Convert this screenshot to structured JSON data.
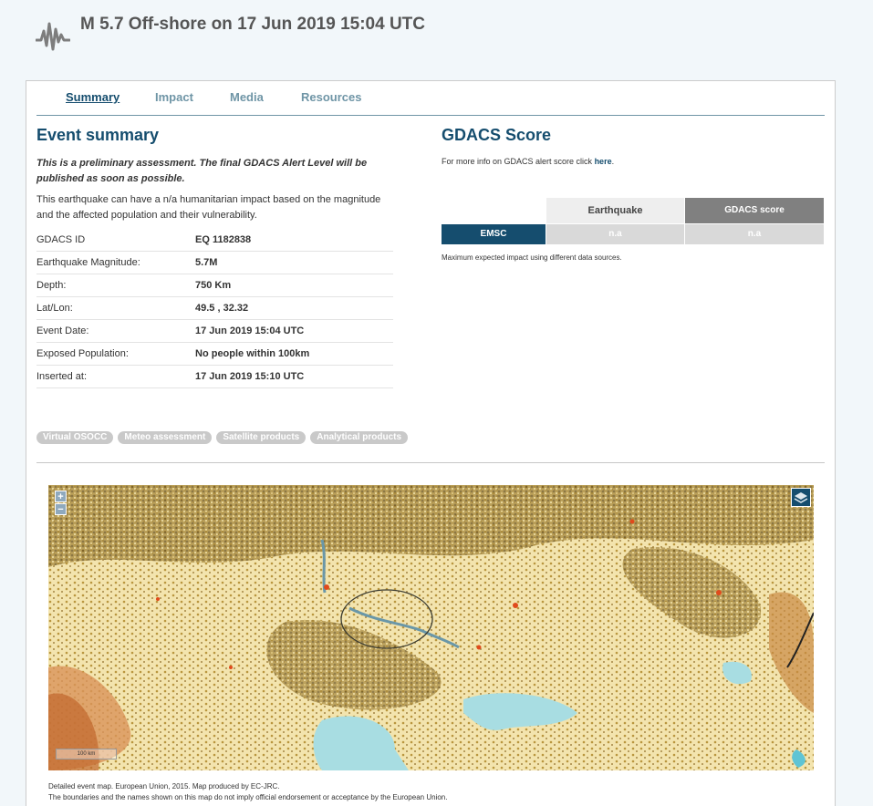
{
  "page": {
    "title": "M 5.7 Off-shore on 17 Jun 2019 15:04 UTC",
    "logo_icon": "seismograph-icon"
  },
  "tabs": [
    {
      "label": "Summary",
      "active": true
    },
    {
      "label": "Impact",
      "active": false
    },
    {
      "label": "Media",
      "active": false
    },
    {
      "label": "Resources",
      "active": false
    }
  ],
  "event_summary": {
    "heading": "Event summary",
    "preliminary": "This is a preliminary assessment. The final GDACS Alert Level will be published as soon as possible.",
    "impact_text": "This earthquake can have a n/a humanitarian impact based on the magnitude and the affected population and their vulnerability.",
    "rows": [
      {
        "label": "GDACS ID",
        "value": "EQ 1182838"
      },
      {
        "label": "Earthquake Magnitude:",
        "value": "5.7M"
      },
      {
        "label": "Depth:",
        "value": "750 Km"
      },
      {
        "label": "Lat/Lon:",
        "value": "49.5 , 32.32"
      },
      {
        "label": "Event Date:",
        "value": "17 Jun 2019 15:04 UTC"
      },
      {
        "label": "Exposed Population:",
        "value": "No people within 100km"
      },
      {
        "label": "Inserted at:",
        "value": "17 Jun 2019 15:10 UTC"
      }
    ],
    "pills": [
      "Virtual OSOCC",
      "Meteo assessment",
      "Satellite products",
      "Analytical products"
    ]
  },
  "gdacs_score": {
    "heading": "GDACS Score",
    "info_text": "For more info on GDACS alert score click ",
    "info_link": "here",
    "info_suffix": ".",
    "col_earthquake": "Earthquake",
    "col_score": "GDACS score",
    "source": "EMSC",
    "earthquake_value": "n.a",
    "score_value": "n.a",
    "note": "Maximum expected impact using different data sources.",
    "colors": {
      "source_bg": "#154d6e",
      "score_header_bg": "#808080",
      "na_bg": "#d9d9d9"
    }
  },
  "map": {
    "zoom_in": "+",
    "zoom_out": "−",
    "layers_icon": "layers-icon",
    "scale_text": "100 km",
    "caption_line1": "Detailed event map. European Union, 2015. Map produced by EC-JRC.",
    "caption_line2": "The boundaries and the names shown on this map do not imply official endorsement or acceptance by the European Union."
  }
}
